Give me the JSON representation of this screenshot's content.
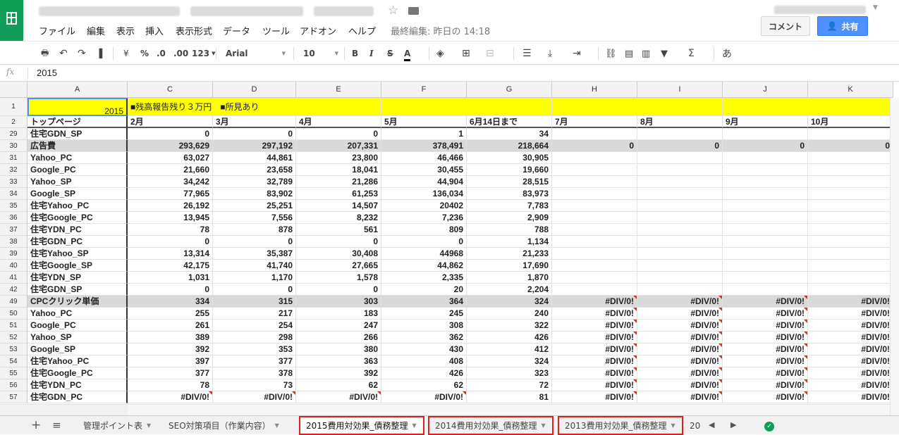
{
  "title_bar": {
    "star_icon": "star-icon",
    "folder_icon": "folder-icon",
    "menu": [
      "ファイル",
      "編集",
      "表示",
      "挿入",
      "表示形式",
      "データ",
      "ツール",
      "アドオン",
      "ヘルプ"
    ],
    "last_edit": "最終編集: 昨日の 14:18",
    "comment_button": "コメント",
    "share_button": "共有"
  },
  "toolbar": {
    "currency": "¥",
    "percent": "%",
    "dec_less": ".0",
    "dec_more": ".00",
    "more_formats": "123",
    "font": "Arial",
    "font_size": "10",
    "bold": "B",
    "italic": "I",
    "strike": "S",
    "text_color": "A",
    "input_tools": "あ",
    "functions": "Σ"
  },
  "formula_bar": {
    "fx": "fx",
    "value": "2015"
  },
  "columns": [
    "A",
    "C",
    "D",
    "E",
    "F",
    "G",
    "H",
    "I",
    "J",
    "K"
  ],
  "rows": [
    {
      "n": "1",
      "cells": [
        "2015",
        "■残高報告残り３万円　■所見あり",
        "",
        "",
        "",
        "",
        "",
        "",
        "",
        ""
      ]
    },
    {
      "n": "2",
      "cells": [
        "トップページ",
        "2月",
        "3月",
        "4月",
        "5月",
        "6月14日まで",
        "7月",
        "8月",
        "9月",
        "10月"
      ]
    },
    {
      "n": "29",
      "cells": [
        "住宅GDN_SP",
        "0",
        "0",
        "0",
        "1",
        "34",
        "",
        "",
        "",
        ""
      ]
    },
    {
      "n": "30",
      "cells": [
        "広告費",
        "293,629",
        "297,192",
        "207,331",
        "378,491",
        "218,664",
        "0",
        "0",
        "0",
        "0"
      ]
    },
    {
      "n": "31",
      "cells": [
        "Yahoo_PC",
        "63,027",
        "44,861",
        "23,800",
        "46,466",
        "30,905",
        "",
        "",
        "",
        ""
      ]
    },
    {
      "n": "32",
      "cells": [
        "Google_PC",
        "21,660",
        "23,658",
        "18,041",
        "30,455",
        "19,660",
        "",
        "",
        "",
        ""
      ]
    },
    {
      "n": "33",
      "cells": [
        "Yahoo_SP",
        "34,242",
        "32,789",
        "21,286",
        "44,904",
        "28,515",
        "",
        "",
        "",
        ""
      ]
    },
    {
      "n": "34",
      "cells": [
        "Google_SP",
        "77,965",
        "83,902",
        "61,253",
        "136,034",
        "83,973",
        "",
        "",
        "",
        ""
      ]
    },
    {
      "n": "35",
      "cells": [
        "住宅Yahoo_PC",
        "26,192",
        "25,251",
        "14,507",
        "20402",
        "7,783",
        "",
        "",
        "",
        ""
      ]
    },
    {
      "n": "36",
      "cells": [
        "住宅Google_PC",
        "13,945",
        "7,556",
        "8,232",
        "7,236",
        "2,909",
        "",
        "",
        "",
        ""
      ]
    },
    {
      "n": "37",
      "cells": [
        "住宅YDN_PC",
        "78",
        "878",
        "561",
        "809",
        "788",
        "",
        "",
        "",
        ""
      ]
    },
    {
      "n": "38",
      "cells": [
        "住宅GDN_PC",
        "0",
        "0",
        "0",
        "0",
        "1,134",
        "",
        "",
        "",
        ""
      ]
    },
    {
      "n": "39",
      "cells": [
        "住宅Yahoo_SP",
        "13,314",
        "35,387",
        "30,408",
        "44968",
        "21,233",
        "",
        "",
        "",
        ""
      ]
    },
    {
      "n": "40",
      "cells": [
        "住宅Google_SP",
        "42,175",
        "41,740",
        "27,665",
        "44,862",
        "17,690",
        "",
        "",
        "",
        ""
      ]
    },
    {
      "n": "41",
      "cells": [
        "住宅YDN_SP",
        "1,031",
        "1,170",
        "1,578",
        "2,335",
        "1,870",
        "",
        "",
        "",
        ""
      ]
    },
    {
      "n": "42",
      "cells": [
        "住宅GDN_SP",
        "0",
        "0",
        "0",
        "20",
        "2,204",
        "",
        "",
        "",
        ""
      ]
    },
    {
      "n": "49",
      "cells": [
        "CPCクリック単価",
        "334",
        "315",
        "303",
        "364",
        "324",
        "#DIV/0!",
        "#DIV/0!",
        "#DIV/0!",
        "#DIV/0!"
      ]
    },
    {
      "n": "50",
      "cells": [
        "Yahoo_PC",
        "255",
        "217",
        "183",
        "245",
        "240",
        "#DIV/0!",
        "#DIV/0!",
        "#DIV/0!",
        "#DIV/0!"
      ]
    },
    {
      "n": "51",
      "cells": [
        "Google_PC",
        "261",
        "254",
        "247",
        "308",
        "322",
        "#DIV/0!",
        "#DIV/0!",
        "#DIV/0!",
        "#DIV/0!"
      ]
    },
    {
      "n": "52",
      "cells": [
        "Yahoo_SP",
        "389",
        "298",
        "266",
        "362",
        "426",
        "#DIV/0!",
        "#DIV/0!",
        "#DIV/0!",
        "#DIV/0!"
      ]
    },
    {
      "n": "53",
      "cells": [
        "Google_SP",
        "392",
        "353",
        "380",
        "430",
        "412",
        "#DIV/0!",
        "#DIV/0!",
        "#DIV/0!",
        "#DIV/0!"
      ]
    },
    {
      "n": "54",
      "cells": [
        "住宅Yahoo_PC",
        "397",
        "377",
        "363",
        "408",
        "324",
        "#DIV/0!",
        "#DIV/0!",
        "#DIV/0!",
        "#DIV/0!"
      ]
    },
    {
      "n": "55",
      "cells": [
        "住宅Google_PC",
        "377",
        "378",
        "392",
        "426",
        "323",
        "#DIV/0!",
        "#DIV/0!",
        "#DIV/0!",
        "#DIV/0!"
      ]
    },
    {
      "n": "56",
      "cells": [
        "住宅YDN_PC",
        "78",
        "73",
        "62",
        "62",
        "72",
        "#DIV/0!",
        "#DIV/0!",
        "#DIV/0!",
        "#DIV/0!"
      ]
    },
    {
      "n": "57",
      "cells": [
        "住宅GDN_PC",
        "#DIV/0!",
        "#DIV/0!",
        "#DIV/0!",
        "#DIV/0!",
        "81",
        "#DIV/0!",
        "#DIV/0!",
        "#DIV/0!",
        "#DIV/0!"
      ]
    }
  ],
  "sheet_tabs": [
    {
      "label": "管理ポイント表",
      "active": false,
      "highlighted": false
    },
    {
      "label": "SEO対策項目（作業内容）",
      "active": false,
      "highlighted": false
    },
    {
      "label": "2015費用対効果_債務整理",
      "active": true,
      "highlighted": true
    },
    {
      "label": "2014費用対効果_債務整理",
      "active": false,
      "highlighted": true
    },
    {
      "label": "2013費用対効果_債務整理",
      "active": false,
      "highlighted": true
    },
    {
      "label": "20",
      "active": false,
      "highlighted": false
    }
  ],
  "colors": {
    "brand_green": "#0f9d58",
    "share_blue": "#4d90fe",
    "highlight_yellow": "#ffff00",
    "shaded_row": "#d9d9d9",
    "tab_highlight_red": "#e02020"
  }
}
